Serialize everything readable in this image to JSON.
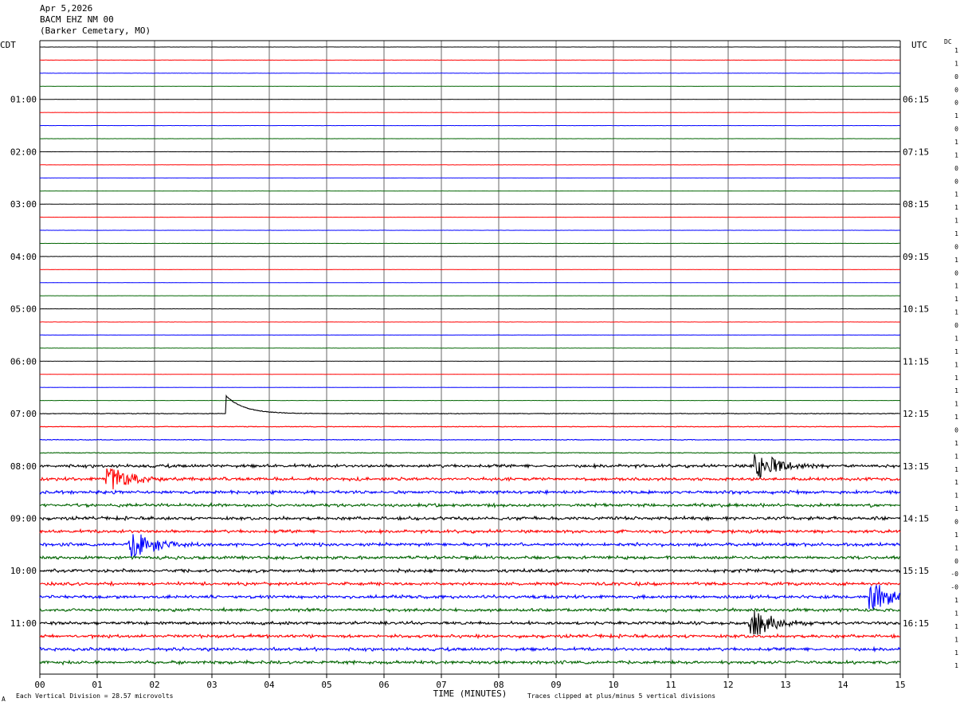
{
  "header": {
    "date": "Apr 5,2026",
    "station": "BACM EHZ NM 00",
    "location": "(Barker Cemetary, MO)"
  },
  "labels": {
    "left_tz": "CDT",
    "right_tz": "UTC",
    "dc": "DC",
    "xlabel": "TIME (MINUTES)",
    "scale_note": "Each Vertical Division =   28.57 microvolts",
    "clip_note": "Traces clipped at plus/minus 5 vertical divisions",
    "corner_mark": "A"
  },
  "chart_data": {
    "type": "line",
    "xlim": [
      0,
      15
    ],
    "x_ticks": [
      "00",
      "01",
      "02",
      "03",
      "04",
      "05",
      "06",
      "07",
      "08",
      "09",
      "10",
      "11",
      "12",
      "13",
      "14",
      "15"
    ],
    "left_hour_labels": [
      "01:00",
      "02:00",
      "03:00",
      "04:00",
      "05:00",
      "06:00",
      "07:00",
      "08:00",
      "09:00",
      "10:00",
      "11:00"
    ],
    "right_hour_labels": [
      "06:15",
      "07:15",
      "08:15",
      "09:15",
      "10:15",
      "11:15",
      "12:15",
      "13:15",
      "14:15",
      "15:15",
      "16:15"
    ],
    "trace_colors": [
      "#000000",
      "#ff0000",
      "#0000ff",
      "#006400"
    ],
    "dc_values": [
      "1",
      "1",
      "0",
      "0",
      "0",
      "1",
      "0",
      "1",
      "1",
      "0",
      "0",
      "1",
      "1",
      "1",
      "1",
      "0",
      "1",
      "0",
      "1",
      "1",
      "1",
      "0",
      "1",
      "1",
      "1",
      "1",
      "1",
      "1",
      "1",
      "0",
      "1",
      "1",
      "1",
      "1",
      "1",
      "1",
      "0",
      "1",
      "1",
      "0",
      "-0",
      "-0",
      "1",
      "1",
      "1",
      "1",
      "1",
      "1",
      "1",
      "1",
      "1",
      "0",
      "1",
      "1",
      "1",
      "-1",
      "0"
    ],
    "events": [
      {
        "trace": 28,
        "description": "step offset",
        "x_minutes": 3.25
      },
      {
        "trace": 33,
        "description": "local event",
        "x_minutes": 1.3
      },
      {
        "trace": 32,
        "description": "event",
        "x_minutes": 12.6
      },
      {
        "trace": 38,
        "description": "event",
        "x_minutes": 1.7
      },
      {
        "trace": 42,
        "description": "event",
        "x_minutes": 14.6
      },
      {
        "trace": 44,
        "description": "event",
        "x_minutes": 12.5
      }
    ]
  }
}
